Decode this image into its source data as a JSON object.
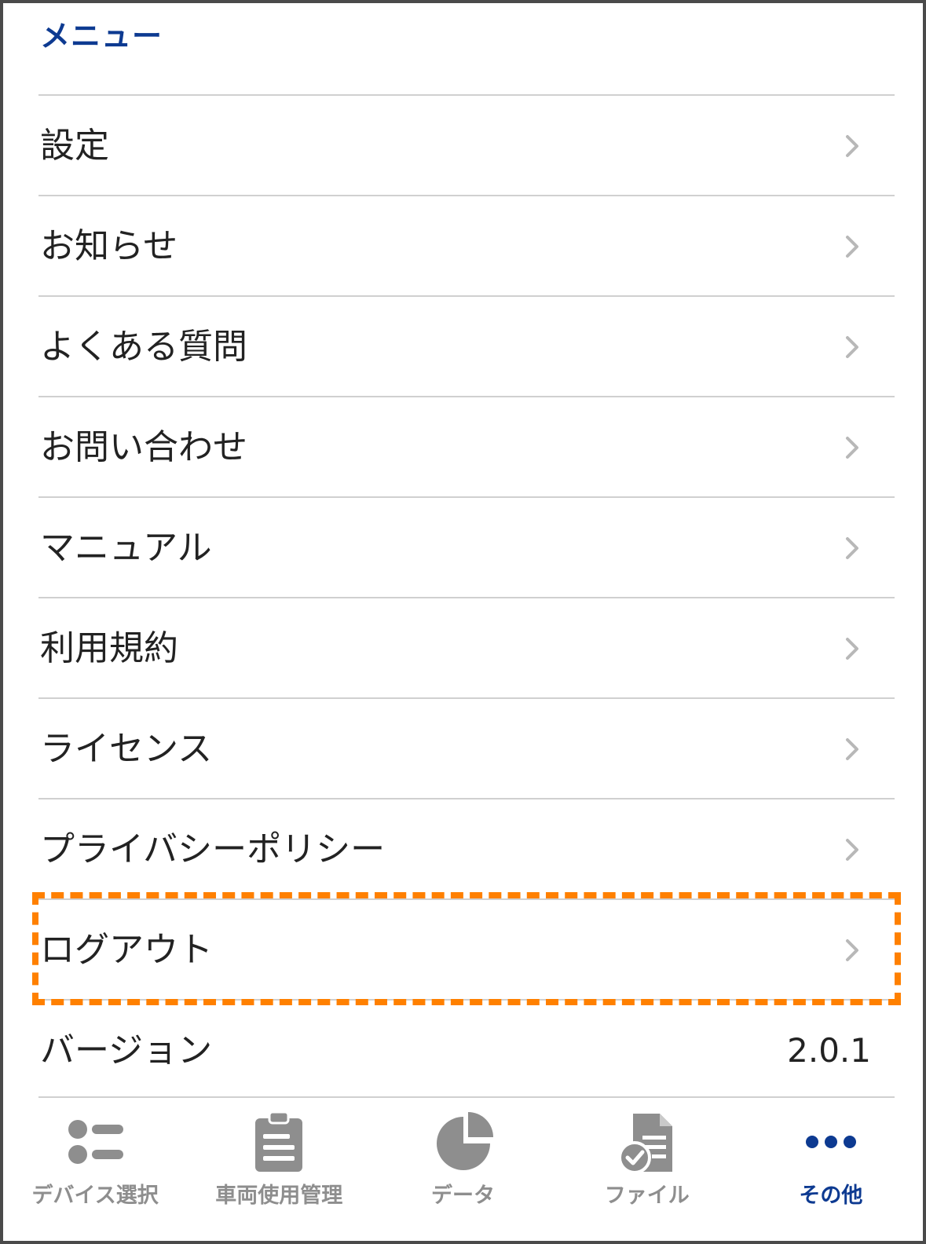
{
  "header": {
    "title": "メニュー"
  },
  "menu": {
    "items": [
      {
        "label": "設定"
      },
      {
        "label": "お知らせ"
      },
      {
        "label": "よくある質問"
      },
      {
        "label": "お問い合わせ"
      },
      {
        "label": "マニュアル"
      },
      {
        "label": "利用規約"
      },
      {
        "label": "ライセンス"
      },
      {
        "label": "プライバシーポリシー"
      },
      {
        "label": "ログアウト"
      }
    ],
    "version": {
      "label": "バージョン",
      "value": "2.0.1"
    }
  },
  "tabbar": {
    "active": "その他",
    "tabs": [
      {
        "label": "デバイス選択",
        "icon": "device-list-icon"
      },
      {
        "label": "車両使用管理",
        "icon": "clipboard-icon"
      },
      {
        "label": "データ",
        "icon": "pie-chart-icon"
      },
      {
        "label": "ファイル",
        "icon": "file-check-icon"
      },
      {
        "label": "その他",
        "icon": "more-dots-icon"
      }
    ]
  },
  "colors": {
    "accent": "#0d3a91",
    "highlight": "#ff8000",
    "tab_inactive": "#8e8e8e",
    "divider": "#d0d0d0"
  }
}
